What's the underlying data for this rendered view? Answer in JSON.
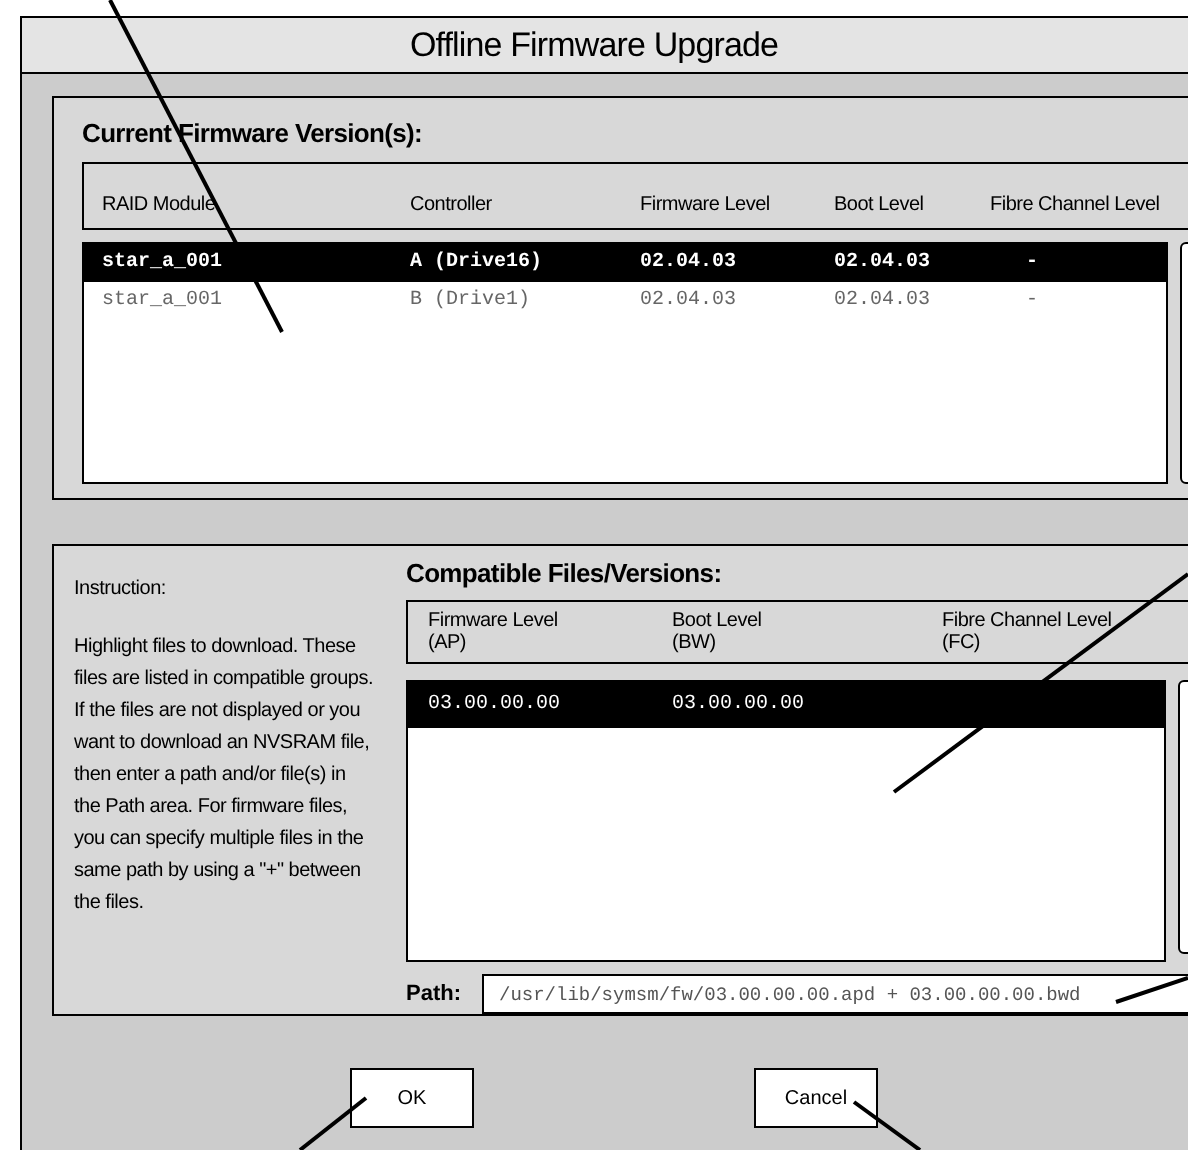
{
  "window": {
    "title": "Offline Firmware Upgrade"
  },
  "current_versions": {
    "title": "Current Firmware Version(s):",
    "columns": [
      "RAID Module",
      "Controller",
      "Firmware Level",
      "Boot Level",
      "Fibre Channel Level"
    ],
    "rows": [
      {
        "cells": [
          "star_a_001",
          "A (Drive16)",
          "02.04.03",
          "02.04.03",
          "-"
        ],
        "selected": true
      },
      {
        "cells": [
          "star_a_001",
          "B (Drive1)",
          "02.04.03",
          "02.04.03",
          "-"
        ],
        "selected": false
      }
    ]
  },
  "instruction": {
    "title": "Instruction:",
    "text": "Highlight files to download. These files are listed in compatible groups. If the files are not displayed or you want to download an NVSRAM file, then enter a path and/or file(s) in the Path area. For firmware files, you can specify multiple files in the same path by using a \"+\" between the files."
  },
  "compatible_files": {
    "title": "Compatible Files/Versions:",
    "columns": [
      {
        "label": "Firmware Level",
        "sub": "(AP)"
      },
      {
        "label": "Boot Level",
        "sub": "(BW)"
      },
      {
        "label": "Fibre Channel Level",
        "sub": "(FC)"
      }
    ],
    "rows": [
      {
        "cells": [
          "03.00.00.00",
          "03.00.00.00"
        ],
        "selected": true
      }
    ]
  },
  "path": {
    "label": "Path:",
    "value": "/usr/lib/symsm/fw/03.00.00.00.apd + 03.00.00.00.bwd"
  },
  "buttons": [
    "OK",
    "Cancel"
  ]
}
